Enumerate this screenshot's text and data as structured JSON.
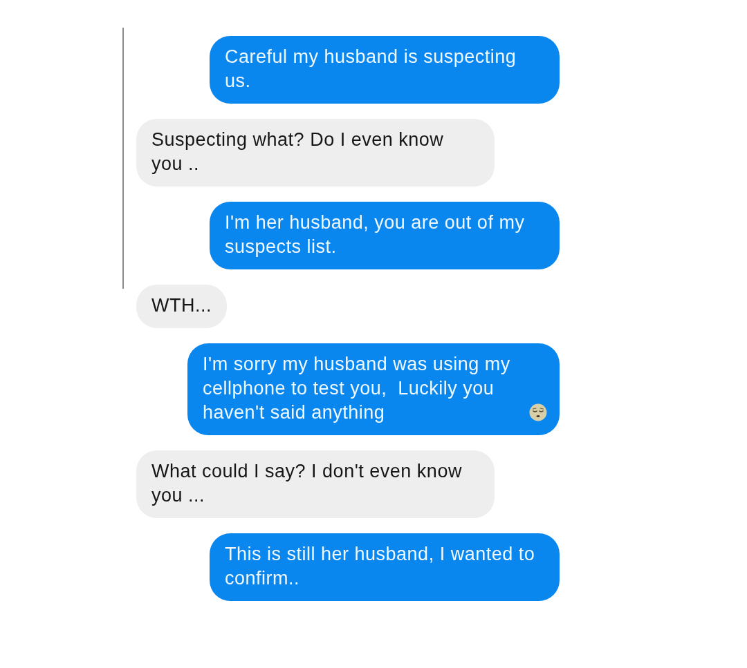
{
  "messages": [
    {
      "kind": "sent",
      "text": "Careful my husband is suspecting us.",
      "emoji": false
    },
    {
      "kind": "received",
      "text": "Suspecting what? Do I even know you ..",
      "emoji": false
    },
    {
      "kind": "sent",
      "text": "I'm her husband, you are out of my suspects list.",
      "emoji": false
    },
    {
      "kind": "received",
      "text": "WTH...",
      "emoji": false
    },
    {
      "kind": "sent",
      "text": "I'm sorry my husband was using my cellphone to test you,  Luckily you haven't said anything",
      "emoji": true
    },
    {
      "kind": "received",
      "text": "What could I say? I don't even know you ...",
      "emoji": false
    },
    {
      "kind": "sent",
      "text": "This is still her husband, I wanted to confirm..",
      "emoji": false
    }
  ]
}
